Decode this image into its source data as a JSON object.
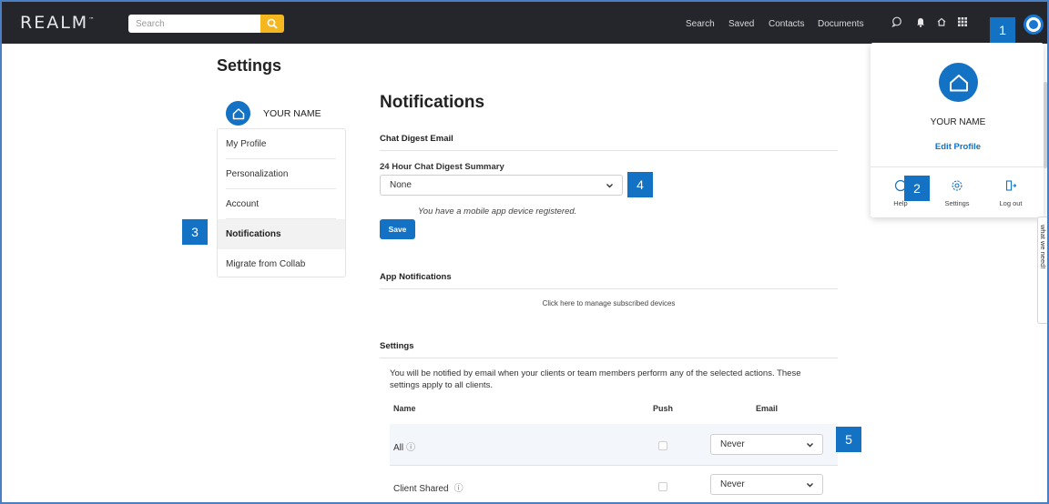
{
  "topbar": {
    "logo": "REALM",
    "logo_tm": "™",
    "search_placeholder": "Search",
    "nav": [
      "Search",
      "Saved",
      "Contacts",
      "Documents"
    ],
    "colors": {
      "bar": "#24262c",
      "search_button": "#f5b720",
      "accent": "#1372c4"
    }
  },
  "badges": [
    "1",
    "2",
    "3",
    "4",
    "5"
  ],
  "settings": {
    "title": "Settings",
    "user_name": "YOUR NAME",
    "menu": [
      "My Profile",
      "Personalization",
      "Account",
      "Notifications",
      "Migrate from Collab"
    ],
    "active_item": "Notifications"
  },
  "notifications": {
    "title": "Notifications",
    "chat_digest": {
      "heading": "Chat Digest Email",
      "label": "24 Hour Chat Digest Summary",
      "selected": "None",
      "note": "You have a mobile app device registered.",
      "save_label": "Save"
    },
    "app_notifications": {
      "heading": "App Notifications",
      "link": "Click here to manage subscribed devices"
    },
    "settings_section": {
      "heading": "Settings",
      "description": "You will be notified by email when your clients or team members perform any of the selected actions. These settings apply to all clients.",
      "columns": [
        "Name",
        "Push",
        "Email"
      ],
      "rows": [
        {
          "name": "All",
          "push": false,
          "email": "Never"
        },
        {
          "name": "Client Shared",
          "push": false,
          "email": "Never"
        }
      ]
    }
  },
  "profile_popup": {
    "name": "YOUR NAME",
    "edit_label": "Edit Profile",
    "actions": [
      "Help",
      "Settings",
      "Log out"
    ]
  },
  "side_tab": {
    "label": "what we need!"
  }
}
